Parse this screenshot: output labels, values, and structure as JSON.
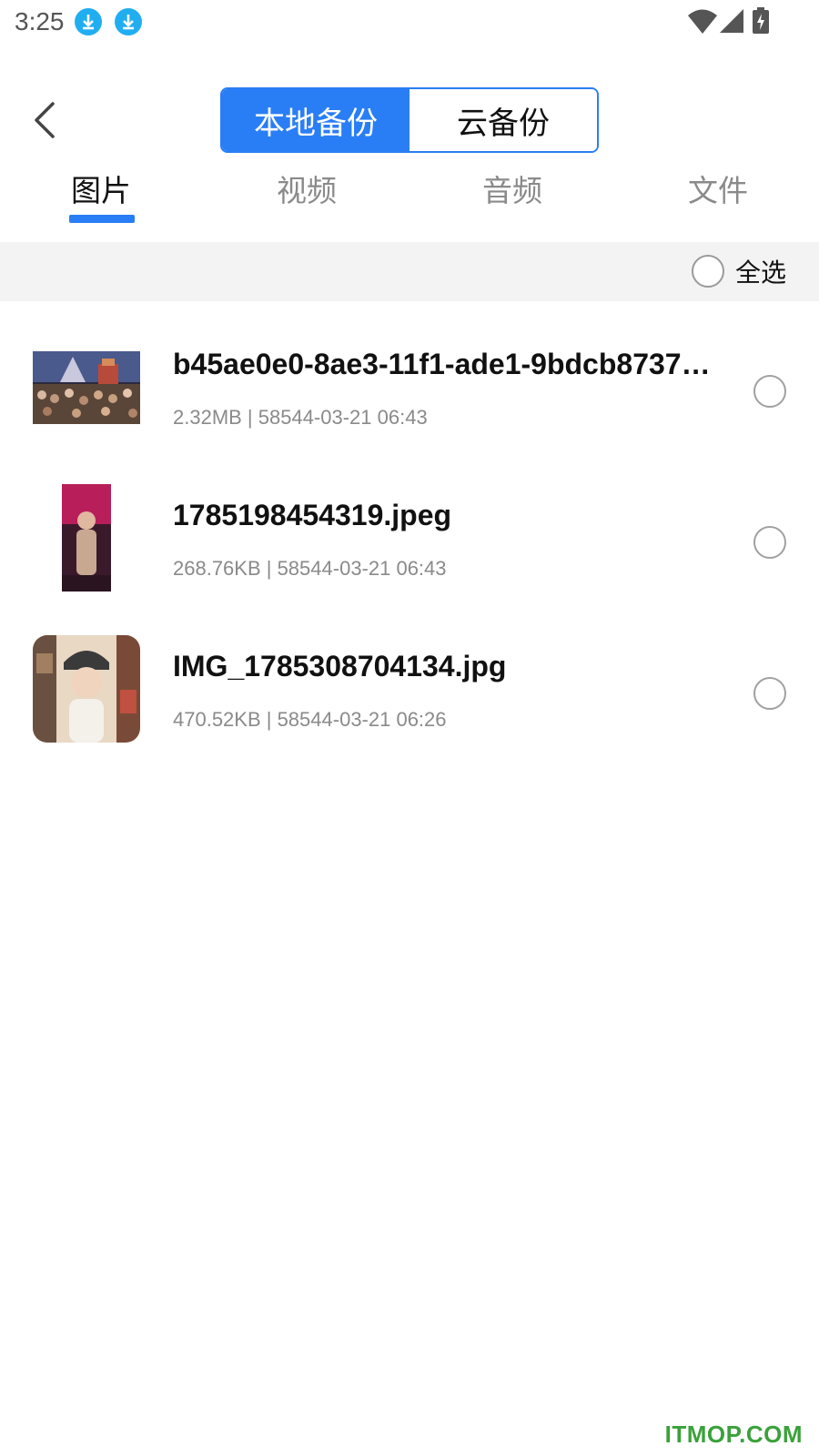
{
  "status_bar": {
    "time": "3:25",
    "icons": [
      "download-icon",
      "download-icon",
      "wifi-icon",
      "signal-icon",
      "battery-charging-icon"
    ]
  },
  "header": {
    "back_icon": "chevron-left-icon",
    "segments": [
      {
        "label": "本地备份",
        "active": true
      },
      {
        "label": "云备份",
        "active": false
      }
    ]
  },
  "tabs": [
    {
      "label": "图片",
      "active": true
    },
    {
      "label": "视频",
      "active": false
    },
    {
      "label": "音频",
      "active": false
    },
    {
      "label": "文件",
      "active": false
    }
  ],
  "select_all": {
    "label": "全选",
    "checked": false
  },
  "files": [
    {
      "name": "b45ae0e0-8ae3-11f1-ade1-9bdcb8737…",
      "meta": "2.32MB | 58544-03-21 06:43",
      "selected": false
    },
    {
      "name": "1785198454319.jpeg",
      "meta": "268.76KB | 58544-03-21 06:43",
      "selected": false
    },
    {
      "name": "IMG_1785308704134.jpg",
      "meta": "470.52KB | 58544-03-21 06:26",
      "selected": false
    }
  ],
  "watermark": "ITMOP.COM",
  "colors": {
    "accent": "#2a7ef5",
    "download_badge": "#21aef0",
    "watermark": "#3aa13a",
    "select_bar_bg": "#f3f3f3"
  }
}
